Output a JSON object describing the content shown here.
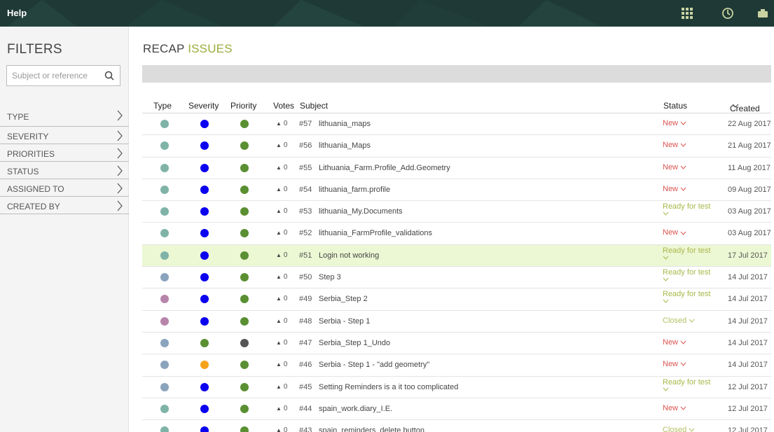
{
  "topbar": {
    "help_label": "Help",
    "color": "#1f3a36",
    "icons": [
      "apps-grid-icon",
      "clock-icon",
      "user-icon"
    ]
  },
  "sidebar": {
    "title": "FILTERS",
    "search_placeholder": "Subject or reference",
    "filters": [
      "TYPE",
      "SEVERITY",
      "PRIORITIES",
      "STATUS",
      "ASSIGNED TO",
      "CREATED BY"
    ]
  },
  "main": {
    "title_prefix": "RECAP",
    "title_accent": "ISSUES",
    "accent_color": "#9bad3c",
    "columns": {
      "type": "Type",
      "severity": "Severity",
      "priority": "Priority",
      "votes": "Votes",
      "subject": "Subject",
      "status": "Status",
      "created": "Created"
    },
    "issues": [
      {
        "type_color": "#7fb3a8",
        "severity_color": "#0b00f0",
        "priority_color": "#5a8f32",
        "votes": "0",
        "ref": "#57",
        "subject": "lithuania_maps",
        "status": "New",
        "status_color": "#d9534f",
        "created": "22 Aug 2017",
        "highlight": false
      },
      {
        "type_color": "#7fb3a8",
        "severity_color": "#0b00f0",
        "priority_color": "#5a8f32",
        "votes": "0",
        "ref": "#56",
        "subject": "lithuania_Maps",
        "status": "New",
        "status_color": "#d9534f",
        "created": "21 Aug 2017",
        "highlight": false
      },
      {
        "type_color": "#7fb3a8",
        "severity_color": "#0b00f0",
        "priority_color": "#5a8f32",
        "votes": "0",
        "ref": "#55",
        "subject": "Lithuania_Farm.Profile_Add.Geometry",
        "status": "New",
        "status_color": "#d9534f",
        "created": "11 Aug 2017",
        "highlight": false
      },
      {
        "type_color": "#7fb3a8",
        "severity_color": "#0b00f0",
        "priority_color": "#5a8f32",
        "votes": "0",
        "ref": "#54",
        "subject": "lithuania_farm.profile",
        "status": "New",
        "status_color": "#d9534f",
        "created": "09 Aug 2017",
        "highlight": false
      },
      {
        "type_color": "#7fb3a8",
        "severity_color": "#0b00f0",
        "priority_color": "#5a8f32",
        "votes": "0",
        "ref": "#53",
        "subject": "lithuania_My.Documents",
        "status": "Ready for test",
        "status_color": "#a8b84a",
        "created": "03 Aug 2017",
        "highlight": false
      },
      {
        "type_color": "#7fb3a8",
        "severity_color": "#0b00f0",
        "priority_color": "#5a8f32",
        "votes": "0",
        "ref": "#52",
        "subject": "lithuania_FarmProfile_validations",
        "status": "New",
        "status_color": "#d9534f",
        "created": "03 Aug 2017",
        "highlight": false
      },
      {
        "type_color": "#7fb3a8",
        "severity_color": "#0b00f0",
        "priority_color": "#5a8f32",
        "votes": "0",
        "ref": "#51",
        "subject": "Login not working",
        "status": "Ready for test",
        "status_color": "#a8b84a",
        "created": "17 Jul 2017",
        "highlight": true
      },
      {
        "type_color": "#8aa4bd",
        "severity_color": "#0b00f0",
        "priority_color": "#5a8f32",
        "votes": "0",
        "ref": "#50",
        "subject": "Step 3",
        "status": "Ready for test",
        "status_color": "#a8b84a",
        "created": "14 Jul 2017",
        "highlight": false
      },
      {
        "type_color": "#b785aa",
        "severity_color": "#0b00f0",
        "priority_color": "#5a8f32",
        "votes": "0",
        "ref": "#49",
        "subject": "Serbia_Step 2",
        "status": "Ready for test",
        "status_color": "#a8b84a",
        "created": "14 Jul 2017",
        "highlight": false
      },
      {
        "type_color": "#b785aa",
        "severity_color": "#0b00f0",
        "priority_color": "#5a8f32",
        "votes": "0",
        "ref": "#48",
        "subject": "Serbia - Step 1",
        "status": "Closed",
        "status_color": "#b5bf63",
        "created": "14 Jul 2017",
        "highlight": false
      },
      {
        "type_color": "#8aa4bd",
        "severity_color": "#5a8f32",
        "priority_color": "#555555",
        "votes": "0",
        "ref": "#47",
        "subject": "Serbia_Step 1_Undo",
        "status": "New",
        "status_color": "#d9534f",
        "created": "14 Jul 2017",
        "highlight": false
      },
      {
        "type_color": "#8aa4bd",
        "severity_color": "#f7a21b",
        "priority_color": "#5a8f32",
        "votes": "0",
        "ref": "#46",
        "subject": "Serbia - Step 1 - \"add geometry\"",
        "status": "New",
        "status_color": "#d9534f",
        "created": "14 Jul 2017",
        "highlight": false
      },
      {
        "type_color": "#8aa4bd",
        "severity_color": "#0b00f0",
        "priority_color": "#5a8f32",
        "votes": "0",
        "ref": "#45",
        "subject": "Setting Reminders is a it too complicated",
        "status": "Ready for test",
        "status_color": "#a8b84a",
        "created": "12 Jul 2017",
        "highlight": false
      },
      {
        "type_color": "#7fb3a8",
        "severity_color": "#0b00f0",
        "priority_color": "#5a8f32",
        "votes": "0",
        "ref": "#44",
        "subject": "spain_work.diary_I.E.",
        "status": "New",
        "status_color": "#d9534f",
        "created": "12 Jul 2017",
        "highlight": false
      },
      {
        "type_color": "#7fb3a8",
        "severity_color": "#0b00f0",
        "priority_color": "#5a8f32",
        "votes": "0",
        "ref": "#43",
        "subject": "spain_reminders_delete button",
        "status": "Closed",
        "status_color": "#b5bf63",
        "created": "12 Jul 2017",
        "highlight": false
      }
    ]
  }
}
